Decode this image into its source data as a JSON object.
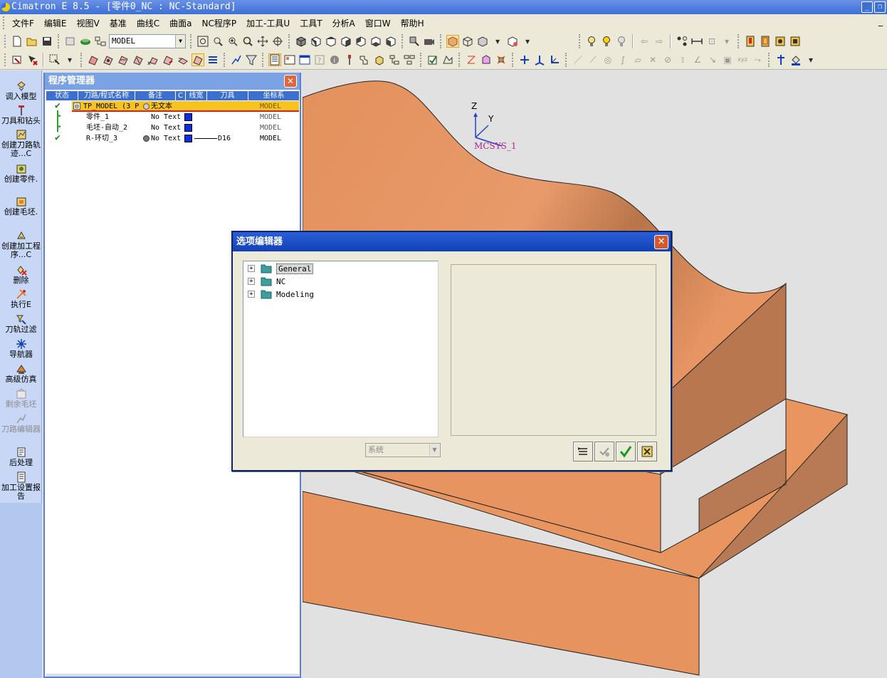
{
  "window": {
    "title": "Cimatron E 8.5 - [零件0_NC : NC-Standard]"
  },
  "menu": {
    "items": [
      "文件F",
      "编辑E",
      "视图V",
      "基准",
      "曲线C",
      "曲面a",
      "NC程序P",
      "加工-工具U",
      "工具T",
      "分析A",
      "窗口W",
      "帮助H"
    ]
  },
  "toolbar": {
    "model_select": "MODEL"
  },
  "sidebar": {
    "items": [
      {
        "label": "调入模型"
      },
      {
        "label": "刀具和钻头"
      },
      {
        "label": "创建刀路轨迹...C"
      },
      {
        "label": "创建零件."
      },
      {
        "label": "创建毛坯."
      },
      {
        "label": "创建加工程序...C"
      },
      {
        "label": "删除"
      },
      {
        "label": "执行E"
      },
      {
        "label": "刀轨过滤"
      },
      {
        "label": "导航器"
      },
      {
        "label": "高级仿真"
      },
      {
        "label": "剩余毛坯"
      },
      {
        "label": "刀路编辑器"
      },
      {
        "label": "后处理"
      },
      {
        "label": "加工设置报告"
      }
    ]
  },
  "program_manager": {
    "title": "程序管理器",
    "columns": [
      "状态",
      "刀路/程式名称",
      "备注",
      "C",
      "线宽",
      "刀具",
      "坐标系"
    ],
    "rows": [
      {
        "name": "TP_MODEL (3 P",
        "note": "无文本",
        "tool": "",
        "cs": "MODEL",
        "sign": "⊟"
      },
      {
        "name": "零件_1",
        "note": "No Text",
        "tool": "",
        "cs": "MODEL"
      },
      {
        "name": "毛坯-自动_2",
        "note": "No Text",
        "tool": "",
        "cs": "MODEL"
      },
      {
        "name": "R-环切_3",
        "note": "No Text",
        "tool": "D16",
        "cs": "MODEL"
      }
    ]
  },
  "viewport": {
    "axis_z": "Z",
    "axis_y": "Y",
    "axis_name": "MCSYS_1"
  },
  "options_dialog": {
    "title": "选项编辑器",
    "tree": [
      {
        "label": "General"
      },
      {
        "label": "NC"
      },
      {
        "label": "Modeling"
      }
    ],
    "system_select": "系统"
  }
}
